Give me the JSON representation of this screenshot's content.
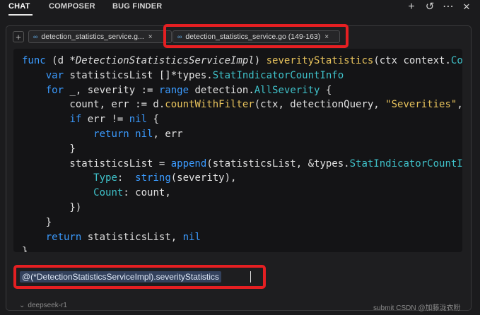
{
  "header": {
    "tabs": [
      {
        "label": "CHAT",
        "active": true
      },
      {
        "label": "COMPOSER",
        "active": false
      },
      {
        "label": "BUG FINDER",
        "active": false
      }
    ],
    "icons": [
      "plus-icon",
      "history-icon",
      "more-icon",
      "close-icon"
    ],
    "glyphs": {
      "plus": "+",
      "history": "↺",
      "more": "⋯",
      "close": "✕"
    }
  },
  "context": {
    "add_glyph": "+",
    "chips": [
      {
        "label": "detection_statistics_service.g...",
        "close": "×"
      },
      {
        "label": "detection_statistics_service.go (149-163)",
        "close": "×"
      }
    ]
  },
  "code": {
    "language": "go",
    "lines": [
      "func (d *DetectionStatisticsServiceImpl) severityStatistics(ctx context.Co",
      "    var statisticsList []*types.StatIndicatorCountInfo",
      "    for _, severity := range detection.AllSeverity {",
      "        count, err := d.countWithFilter(ctx, detectionQuery, \"Severities\",",
      "        if err != nil {",
      "            return nil, err",
      "        }",
      "        statisticsList = append(statisticsList, &types.StatIndicatorCountI",
      "            Type:  string(severity),",
      "            Count: count,",
      "        })",
      "    }",
      "    return statisticsList, nil",
      "}"
    ]
  },
  "input": {
    "mention": "@(*DetectionStatisticsServiceImpl).severityStatistics"
  },
  "footer": {
    "model": "deepseek-r1",
    "chevron": "⌄",
    "submit_text": "submit  CSDN @加藤泷衣粉"
  },
  "colors": {
    "keyword": "#3b9bff",
    "function": "#e8c35c",
    "type": "#3fc1c9",
    "highlight_border": "#e51f22"
  }
}
